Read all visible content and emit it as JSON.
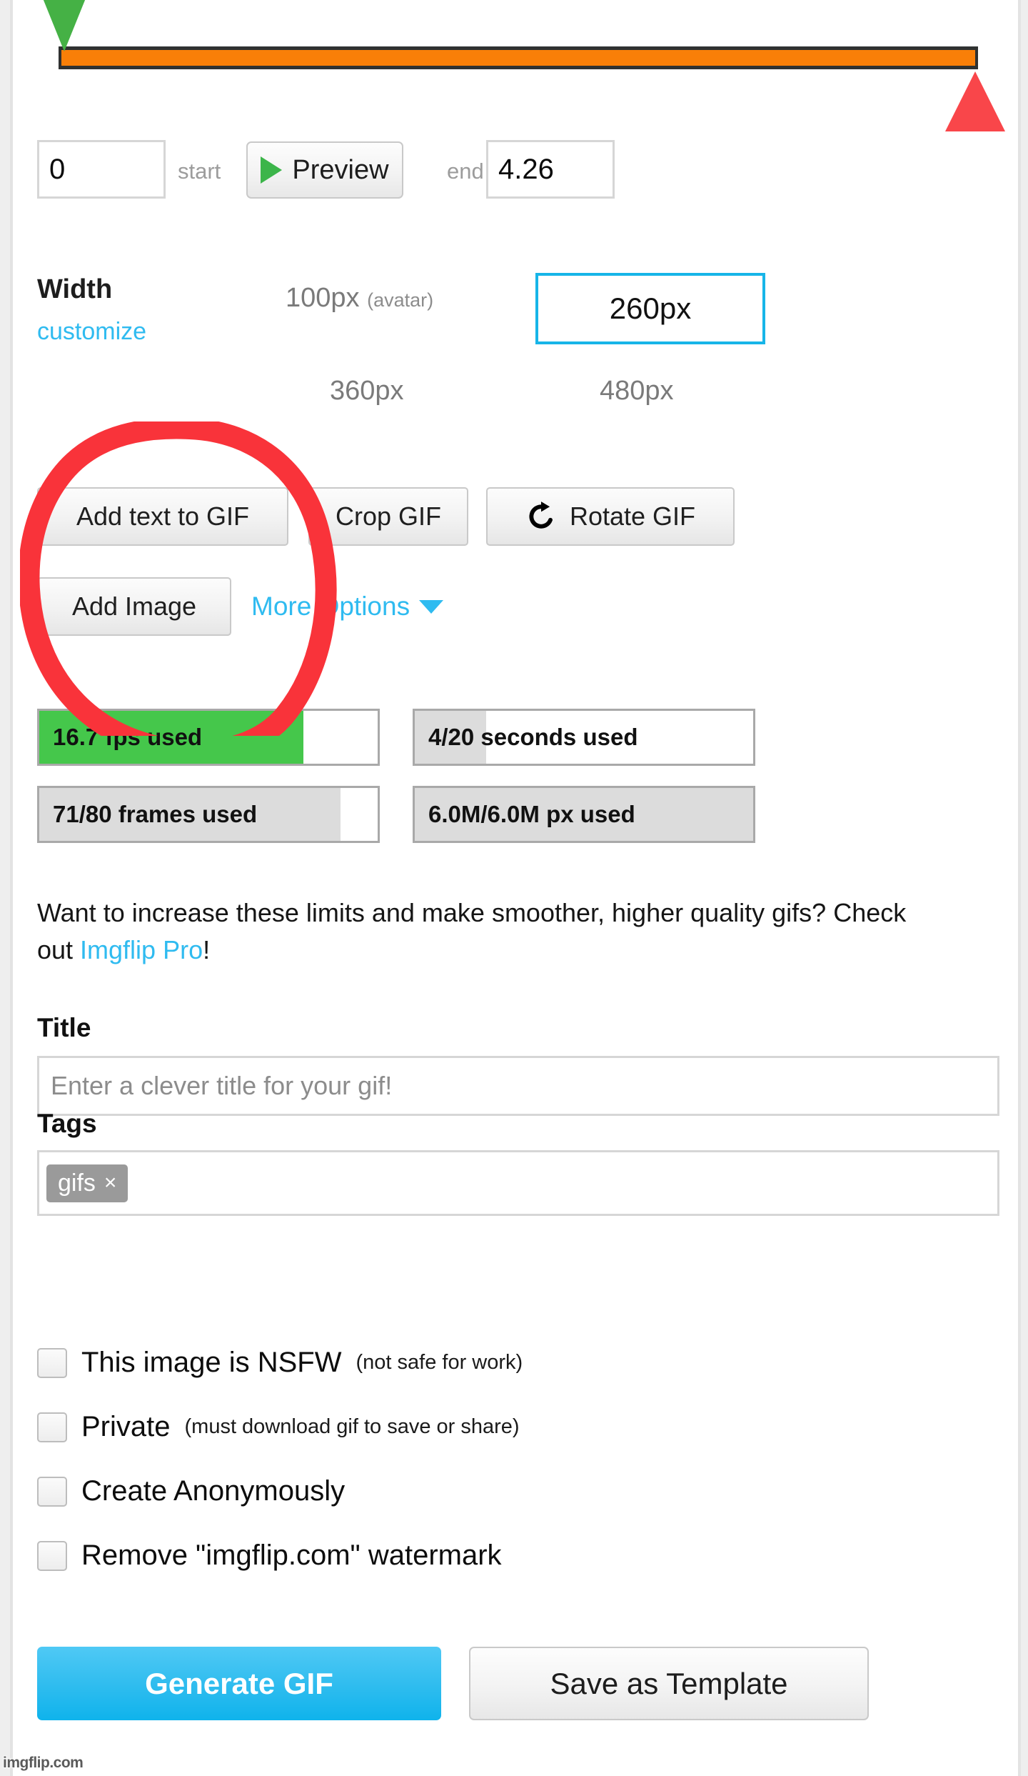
{
  "timeline": {
    "start_handle_icon": "green-down-triangle",
    "end_handle_icon": "red-up-triangle",
    "bar_color": "#f97f08",
    "frame_color": "#2f3131"
  },
  "time_row": {
    "start_value": "0",
    "start_label": "start",
    "preview_label": "Preview",
    "end_label": "end",
    "end_value": "4.26"
  },
  "width": {
    "title": "Width",
    "customize_label": "customize",
    "options": [
      {
        "label": "100px",
        "sub": "(avatar)",
        "selected": false
      },
      {
        "label": "260px",
        "sub": "",
        "selected": true
      },
      {
        "label": "360px",
        "sub": "",
        "selected": false
      },
      {
        "label": "480px",
        "sub": "",
        "selected": false
      }
    ],
    "selected_value": "260px",
    "accent_color": "#17b5e8"
  },
  "actions": {
    "add_text_label": "Add text to GIF",
    "crop_label": "Crop GIF",
    "rotate_label": "Rotate GIF",
    "add_image_label": "Add Image",
    "more_options_label": "More Options",
    "more_options_color": "#2fbbf0"
  },
  "stats": [
    {
      "text": "16.7 fps used",
      "fill_percent": 78,
      "fill_color": "#45c74b",
      "style": "green"
    },
    {
      "text": "4/20 seconds used",
      "fill_percent": 21,
      "fill_color": "#dcdcdc",
      "style": "grey"
    },
    {
      "text": "71/80 frames used",
      "fill_percent": 89,
      "fill_color": "#dcdcdc",
      "style": "grey"
    },
    {
      "text": "6.0M/6.0M px used",
      "fill_percent": 100,
      "fill_color": "#dcdcdc",
      "style": "grey"
    }
  ],
  "pro_notice": {
    "text_before": "Want to increase these limits and make smoother, higher quality gifs? Check out ",
    "link_label": "Imgflip Pro",
    "text_after": "!"
  },
  "form": {
    "title_label": "Title",
    "title_value": "",
    "title_placeholder": "Enter a clever title for your gif!",
    "tags_label": "Tags",
    "tags": [
      {
        "label": "gifs",
        "remove_icon": "×"
      }
    ],
    "tags_placeholder": ""
  },
  "checkboxes": [
    {
      "main": "This image is NSFW",
      "sub": "(not safe for work)",
      "checked": false
    },
    {
      "main": "Private",
      "sub": "(must download gif to save or share)",
      "checked": false
    },
    {
      "main": "Create Anonymously",
      "sub": "",
      "checked": false
    },
    {
      "main": "Remove \"imgflip.com\" watermark",
      "sub": "",
      "checked": false
    }
  ],
  "footer": {
    "generate_label": "Generate GIF",
    "generate_color": "#31bdef",
    "save_template_label": "Save as Template"
  },
  "watermark": {
    "text": "imgflip.com"
  },
  "annotation": {
    "shape": "hand-drawn-red-circle",
    "color": "#f9333a"
  }
}
